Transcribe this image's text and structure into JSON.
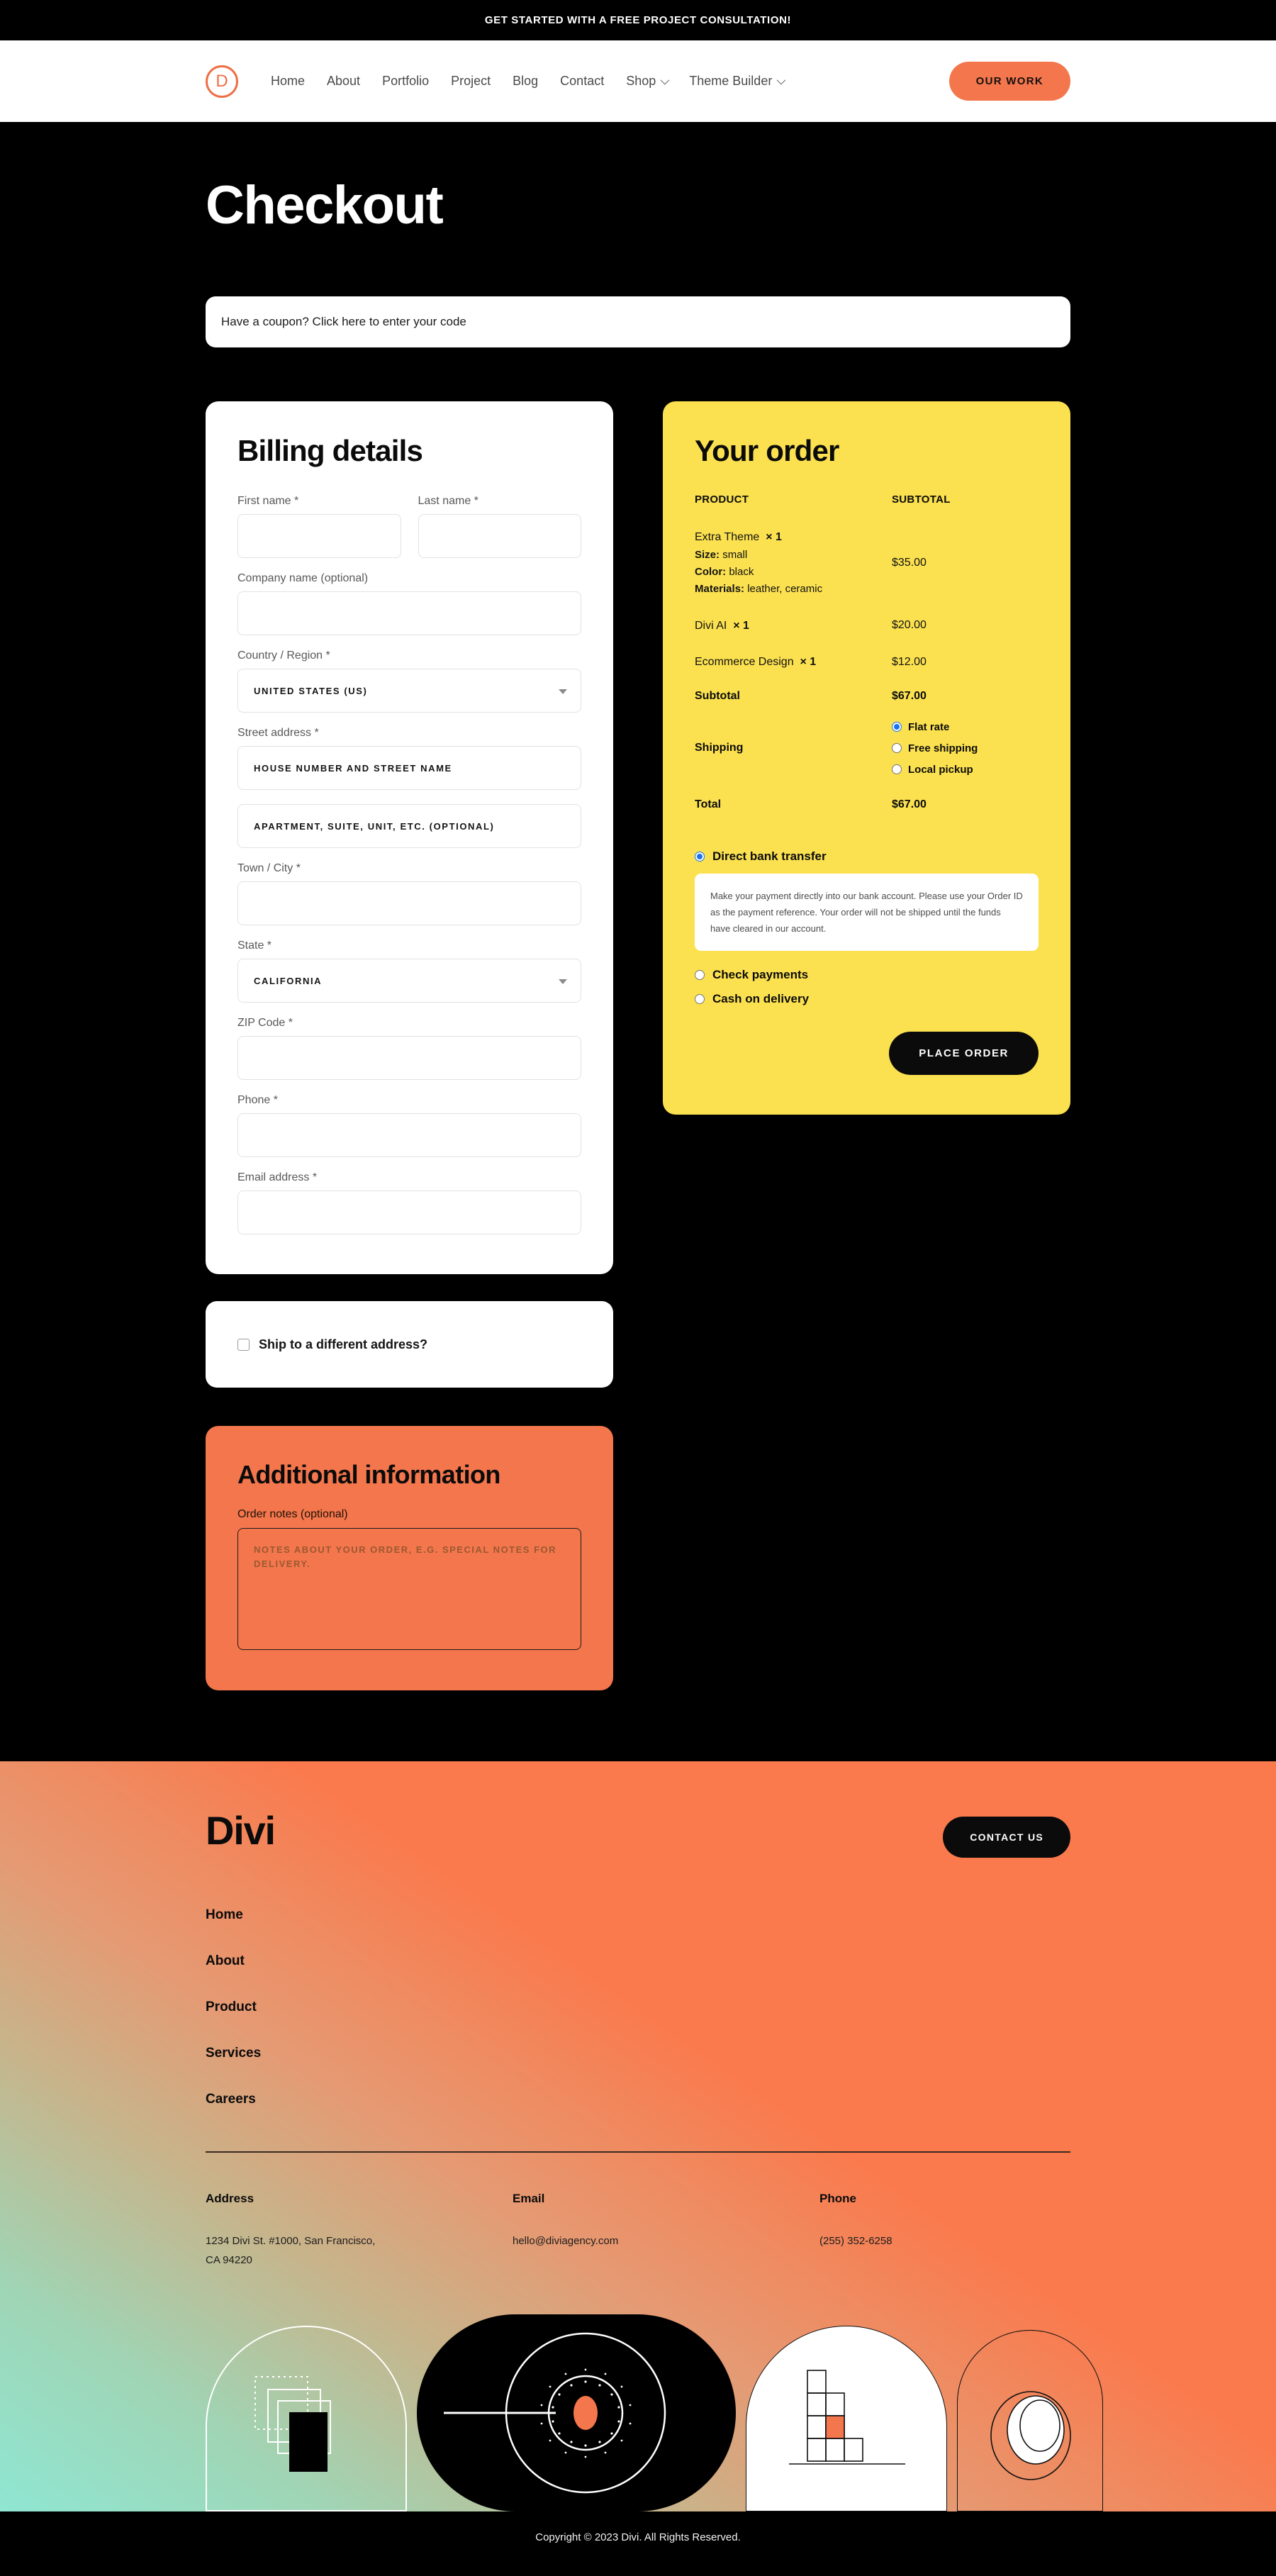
{
  "announce": {
    "text": "GET STARTED WITH A FREE PROJECT CONSULTATION!"
  },
  "nav": {
    "logo_letter": "D",
    "links": [
      {
        "label": "Home",
        "has_chevron": false
      },
      {
        "label": "About",
        "has_chevron": false
      },
      {
        "label": "Portfolio",
        "has_chevron": false
      },
      {
        "label": "Project",
        "has_chevron": false
      },
      {
        "label": "Blog",
        "has_chevron": false
      },
      {
        "label": "Contact",
        "has_chevron": false
      },
      {
        "label": "Shop",
        "has_chevron": true
      },
      {
        "label": "Theme Builder",
        "has_chevron": true
      }
    ],
    "cta_label": "OUR WORK"
  },
  "page": {
    "title": "Checkout",
    "coupon_text": "Have a coupon? Click here to enter your code"
  },
  "billing": {
    "title": "Billing details",
    "first_name": {
      "label": "First name *",
      "value": "",
      "placeholder": ""
    },
    "last_name": {
      "label": "Last name *",
      "value": "",
      "placeholder": ""
    },
    "company": {
      "label": "Company name (optional)",
      "value": "",
      "placeholder": ""
    },
    "country": {
      "label": "Country / Region *",
      "value": "UNITED STATES (US)"
    },
    "street": {
      "label": "Street address *",
      "value": "",
      "placeholder": "HOUSE NUMBER AND STREET NAME"
    },
    "street2": {
      "value": "",
      "placeholder": "APARTMENT, SUITE, UNIT, ETC. (OPTIONAL)"
    },
    "city": {
      "label": "Town / City *",
      "value": "",
      "placeholder": ""
    },
    "state": {
      "label": "State *",
      "value": "CALIFORNIA"
    },
    "zip": {
      "label": "ZIP Code *",
      "value": "",
      "placeholder": ""
    },
    "phone": {
      "label": "Phone *",
      "value": "",
      "placeholder": ""
    },
    "email": {
      "label": "Email address *",
      "value": "",
      "placeholder": ""
    }
  },
  "ship_different": {
    "label": "Ship to a different address?",
    "checked": false
  },
  "additional": {
    "title": "Additional information",
    "notes_label": "Order notes (optional)",
    "notes_value": "",
    "notes_placeholder": "NOTES ABOUT YOUR ORDER, E.G. SPECIAL NOTES FOR DELIVERY."
  },
  "order": {
    "title": "Your order",
    "head_product": "PRODUCT",
    "head_subtotal": "SUBTOTAL",
    "items": [
      {
        "name": "Extra Theme",
        "qty": "× 1",
        "meta": [
          {
            "key": "Size:",
            "value": "small"
          },
          {
            "key": "Color:",
            "value": "black"
          },
          {
            "key": "Materials:",
            "value": "leather, ceramic"
          }
        ],
        "price": "$35.00"
      },
      {
        "name": "Divi AI",
        "qty": "× 1",
        "meta": [],
        "price": "$20.00"
      },
      {
        "name": "Ecommerce Design",
        "qty": "× 1",
        "meta": [],
        "price": "$12.00"
      }
    ],
    "subtotal_label": "Subtotal",
    "subtotal_value": "$67.00",
    "shipping_label": "Shipping",
    "shipping_options": [
      {
        "label": "Flat rate",
        "selected": true
      },
      {
        "label": "Free shipping",
        "selected": false
      },
      {
        "label": "Local pickup",
        "selected": false
      }
    ],
    "total_label": "Total",
    "total_value": "$67.00",
    "payment_options": [
      {
        "label": "Direct bank transfer",
        "selected": true
      },
      {
        "label": "Check payments",
        "selected": false
      },
      {
        "label": "Cash on delivery",
        "selected": false
      }
    ],
    "bank_description": "Make your payment directly into our bank account. Please use your Order ID as the payment reference. Your order will not be shipped until the funds have cleared in our account.",
    "place_order_label": "PLACE ORDER"
  },
  "footer": {
    "brand": "Divi",
    "contact_label": "CONTACT US",
    "nav": [
      "Home",
      "About",
      "Product",
      "Services",
      "Careers"
    ],
    "columns": [
      {
        "title": "Address",
        "text": "1234 Divi St. #1000, San Francisco, CA 94220"
      },
      {
        "title": "Email",
        "text": "hello@diviagency.com"
      },
      {
        "title": "Phone",
        "text": "(255) 352-6258"
      }
    ],
    "copyright": "Copyright © 2023 Divi. All Rights Reserved."
  },
  "colors": {
    "orange": "#f4764c",
    "yellow": "#fbe14f",
    "black": "#000000",
    "radio_blue": "#1a73e8"
  }
}
